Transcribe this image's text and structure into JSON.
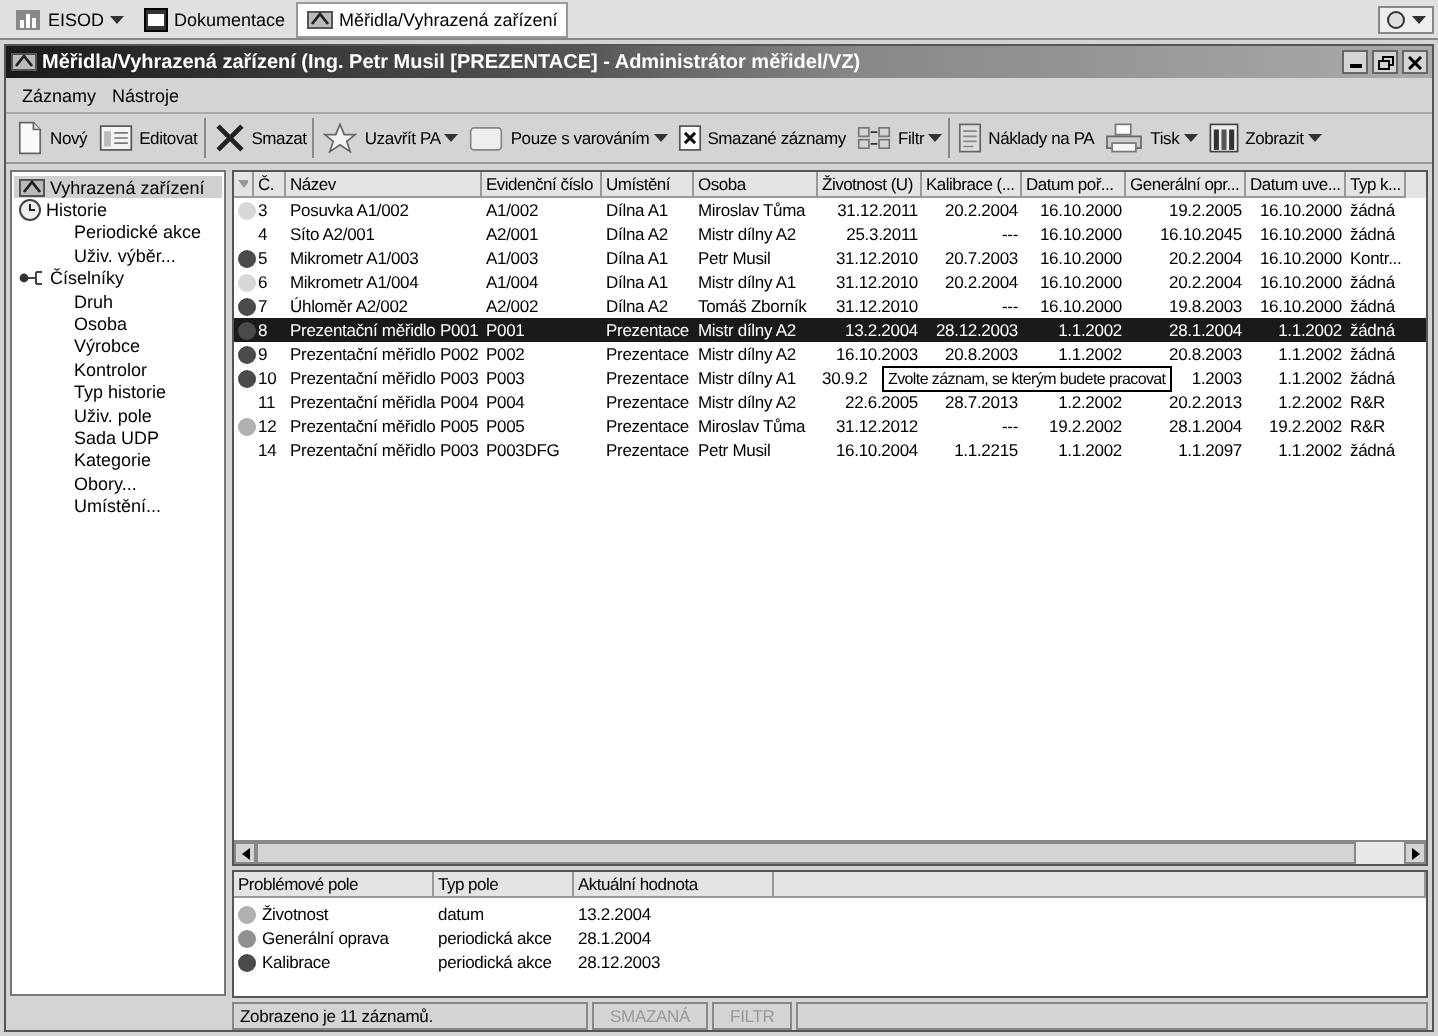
{
  "taskbar": {
    "items": [
      {
        "label": "EISOD",
        "dropdown": true,
        "selected": false
      },
      {
        "label": "Dokumentace",
        "dropdown": false,
        "selected": false
      },
      {
        "label": "Měřidla/Vyhrazená zařízení",
        "dropdown": false,
        "selected": true
      }
    ]
  },
  "window": {
    "title": "Měřidla/Vyhrazená zařízení (Ing. Petr Musil [PREZENTACE] - Administrátor měřidel/VZ)"
  },
  "menu": [
    "Záznamy",
    "Nástroje"
  ],
  "toolbar": [
    {
      "label": "Nový",
      "dropdown": false
    },
    {
      "label": "Editovat",
      "dropdown": false
    },
    {
      "label": "Smazat",
      "dropdown": false
    },
    {
      "label": "Uzavřít PA",
      "dropdown": true
    },
    {
      "label": "Pouze s varováním",
      "dropdown": true
    },
    {
      "label": "Smazané záznamy",
      "dropdown": false
    },
    {
      "label": "Filtr",
      "dropdown": true
    },
    {
      "label": "Náklady na PA",
      "dropdown": false
    },
    {
      "label": "Tisk",
      "dropdown": true
    },
    {
      "label": "Zobrazit",
      "dropdown": true
    }
  ],
  "sidebar": {
    "items": [
      {
        "label": "Vyhrazená zařízení",
        "selected": true
      },
      {
        "label": "Historie",
        "selected": false,
        "children": [
          {
            "label": "Periodické akce",
            "selected": false
          },
          {
            "label": "Uživ. výběr...",
            "selected": false
          }
        ]
      },
      {
        "label": "Číselníky",
        "selected": false,
        "children": [
          {
            "label": "Druh",
            "selected": false
          },
          {
            "label": "Osoba",
            "selected": false
          },
          {
            "label": "Výrobce",
            "selected": false
          },
          {
            "label": "Kontrolor",
            "selected": false
          },
          {
            "label": "Typ historie",
            "selected": false
          },
          {
            "label": "Uživ. pole",
            "selected": false
          },
          {
            "label": "Sada UDP",
            "selected": false
          },
          {
            "label": "Kategorie",
            "selected": false
          },
          {
            "label": "Obory...",
            "selected": false
          },
          {
            "label": "Umístění...",
            "selected": false
          }
        ]
      }
    ]
  },
  "table": {
    "columns": [
      "Č.",
      "Název",
      "Evidenční číslo",
      "Umístění",
      "Osoba",
      "Životnost (U)",
      "Kalibrace (...",
      "Datum poř...",
      "Generální opr...",
      "Datum uve...",
      "Typ k..."
    ],
    "rows": [
      {
        "color": "#d8d8d8",
        "selected": false,
        "cells": [
          "3",
          "Posuvka A1/002",
          "A1/002",
          "Dílna A1",
          "Miroslav Tůma",
          "31.12.2011",
          "20.2.2004",
          "16.10.2000",
          "19.2.2005",
          "16.10.2000",
          "žádná"
        ]
      },
      {
        "selected": false,
        "cells": [
          "4",
          "Síto A2/001",
          "A2/001",
          "Dílna A2",
          "Mistr dílny A2",
          "25.3.2011",
          "---",
          "16.10.2000",
          "16.10.2045",
          "16.10.2000",
          "žádná"
        ]
      },
      {
        "color": "#4a4a4a",
        "selected": false,
        "cells": [
          "5",
          "Mikrometr A1/003",
          "A1/003",
          "Dílna A1",
          "Petr Musil",
          "31.12.2010",
          "20.7.2003",
          "16.10.2000",
          "20.2.2004",
          "16.10.2000",
          "Kontr..."
        ]
      },
      {
        "color": "#d8d8d8",
        "selected": false,
        "cells": [
          "6",
          "Mikrometr A1/004",
          "A1/004",
          "Dílna A1",
          "Mistr dílny A1",
          "31.12.2010",
          "20.2.2004",
          "16.10.2000",
          "20.2.2004",
          "16.10.2000",
          "žádná"
        ]
      },
      {
        "color": "#4a4a4a",
        "selected": false,
        "cells": [
          "7",
          "Úhloměr A2/002",
          "A2/002",
          "Dílna A2",
          "Tomáš Zborník",
          "31.12.2010",
          "---",
          "16.10.2000",
          "19.8.2003",
          "16.10.2000",
          "žádná"
        ]
      },
      {
        "color": "#4a4a4a",
        "selected": true,
        "cells": [
          "8",
          "Prezentační měřidlo P001",
          "P001",
          "Prezentace",
          "Mistr dílny A2",
          "13.2.2004",
          "28.12.2003",
          "1.1.2002",
          "28.1.2004",
          "1.1.2002",
          "žádná"
        ]
      },
      {
        "color": "#4a4a4a",
        "selected": false,
        "cells": [
          "9",
          "Prezentační měřidlo P002",
          "P002",
          "Prezentace",
          "Mistr dílny A2",
          "16.10.2003",
          "20.8.2003",
          "1.1.2002",
          "20.8.2003",
          "1.1.2002",
          "žádná"
        ]
      },
      {
        "color": "#4a4a4a",
        "selected": false,
        "tooltip": "Zvolte záznam, se kterým budete pracovat",
        "cells": [
          "10",
          "Prezentační měřidlo P003",
          "P003",
          "Prezentace",
          "Mistr dílny A1",
          "30.9.2",
          null,
          null,
          "1.2003",
          "1.1.2002",
          "žádná"
        ]
      },
      {
        "selected": false,
        "cells": [
          "11",
          "Prezentační měřidla P004",
          "P004",
          "Prezentace",
          "Mistr dílny A2",
          "22.6.2005",
          "28.7.2013",
          "1.2.2002",
          "20.2.2013",
          "1.2.2002",
          "R&R"
        ]
      },
      {
        "color": "#b0b0b0",
        "selected": false,
        "cells": [
          "12",
          "Prezentační měřidlo P005",
          "P005",
          "Prezentace",
          "Miroslav Tůma",
          "31.12.2012",
          "---",
          "19.2.2002",
          "28.1.2004",
          "19.2.2002",
          "R&R"
        ]
      },
      {
        "selected": false,
        "cells": [
          "14",
          "Prezentační měřidlo P003",
          "P003DFG",
          "Prezentace",
          "Petr Musil",
          "16.10.2004",
          "1.1.2215",
          "1.1.2002",
          "1.1.2097",
          "1.1.2002",
          "žádná"
        ]
      }
    ]
  },
  "details": {
    "columns": [
      "Problémové pole",
      "Typ pole",
      "Aktuální hodnota"
    ],
    "rows": [
      {
        "color": "#b0b0b0",
        "cells": [
          "Životnost",
          "datum",
          "13.2.2004"
        ]
      },
      {
        "color": "#909090",
        "cells": [
          "Generální oprava",
          "periodická akce",
          "28.1.2004"
        ]
      },
      {
        "color": "#4a4a4a",
        "cells": [
          "Kalibrace",
          "periodická akce",
          "28.12.2003"
        ]
      }
    ]
  },
  "status_bar": {
    "message": "Zobrazeno je 11 záznamů.",
    "indicators": [
      {
        "label": "SMAZANÁ",
        "disabled": true
      },
      {
        "label": "FILTR",
        "disabled": true
      }
    ]
  }
}
